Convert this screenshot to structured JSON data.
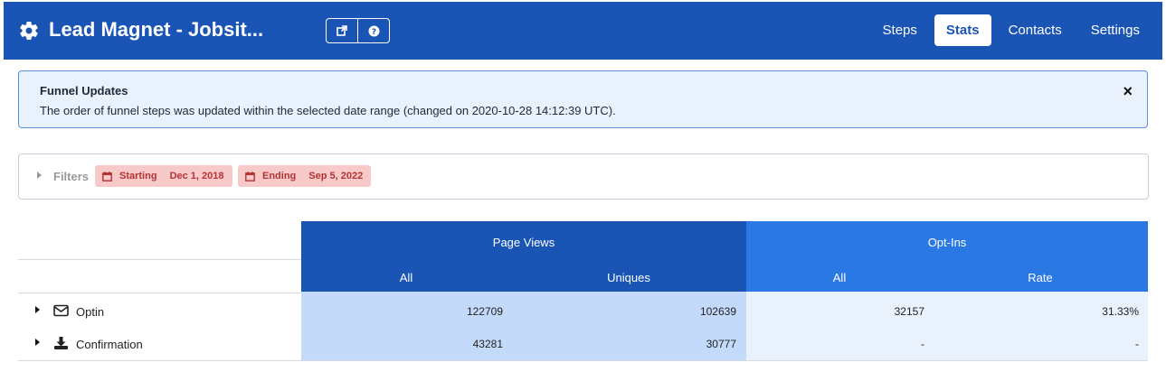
{
  "header": {
    "title": "Lead Magnet - Jobsit...",
    "nav": [
      {
        "label": "Steps",
        "active": false
      },
      {
        "label": "Stats",
        "active": true
      },
      {
        "label": "Contacts",
        "active": false
      },
      {
        "label": "Settings",
        "active": false
      }
    ],
    "icons": [
      "gear-icon",
      "external-link-icon",
      "help-icon"
    ],
    "bg_color": "#1a55b5"
  },
  "alert": {
    "heading": "Funnel Updates",
    "message": "The order of funnel steps was updated within the selected date range (changed on 2020-10-28 14:12:39 UTC).",
    "close": "×"
  },
  "filters": {
    "label": "Filters",
    "starting": {
      "label": "Starting",
      "value": "Dec 1, 2018"
    },
    "ending": {
      "label": "Ending",
      "value": "Sep 5, 2022"
    },
    "pill_color": "#f7c9c9"
  },
  "table": {
    "groups": [
      {
        "label": "Page Views",
        "color": "#1a55b5",
        "columns": [
          "All",
          "Uniques"
        ]
      },
      {
        "label": "Opt-Ins",
        "color": "#2a78e4",
        "columns": [
          "All",
          "Rate"
        ]
      }
    ],
    "rows": [
      {
        "label": "Optin",
        "icon": "envelope-icon",
        "pv_all": "122709",
        "pv_uniques": "102639",
        "oi_all": "32157",
        "oi_rate": "31.33%"
      },
      {
        "label": "Confirmation",
        "icon": "download-icon",
        "pv_all": "43281",
        "pv_uniques": "30777",
        "oi_all": "-",
        "oi_rate": "-"
      }
    ]
  }
}
